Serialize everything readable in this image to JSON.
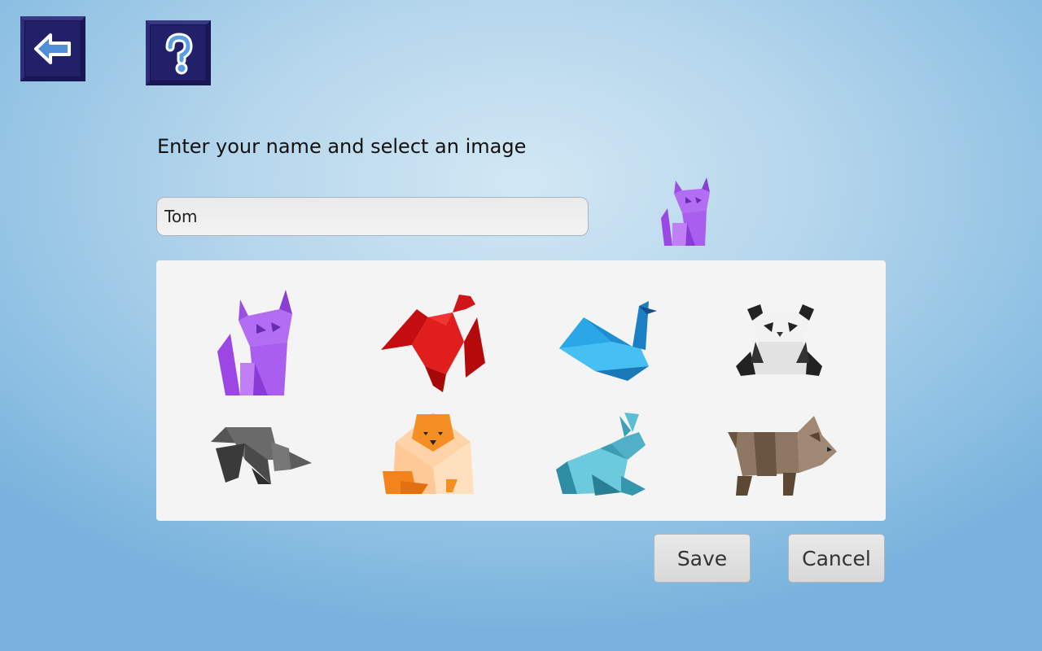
{
  "toolbar": {
    "back_icon": "back-arrow-icon",
    "help_icon": "question-mark-icon",
    "button_color": "#23206a"
  },
  "prompt": "Enter your name and select an image",
  "name_field": {
    "value": "Tom"
  },
  "selected_avatar": "cat",
  "avatars": [
    "cat",
    "rooster",
    "swan",
    "panda",
    "rhino",
    "lion",
    "rabbit",
    "bear"
  ],
  "buttons": {
    "save": "Save",
    "cancel": "Cancel"
  }
}
